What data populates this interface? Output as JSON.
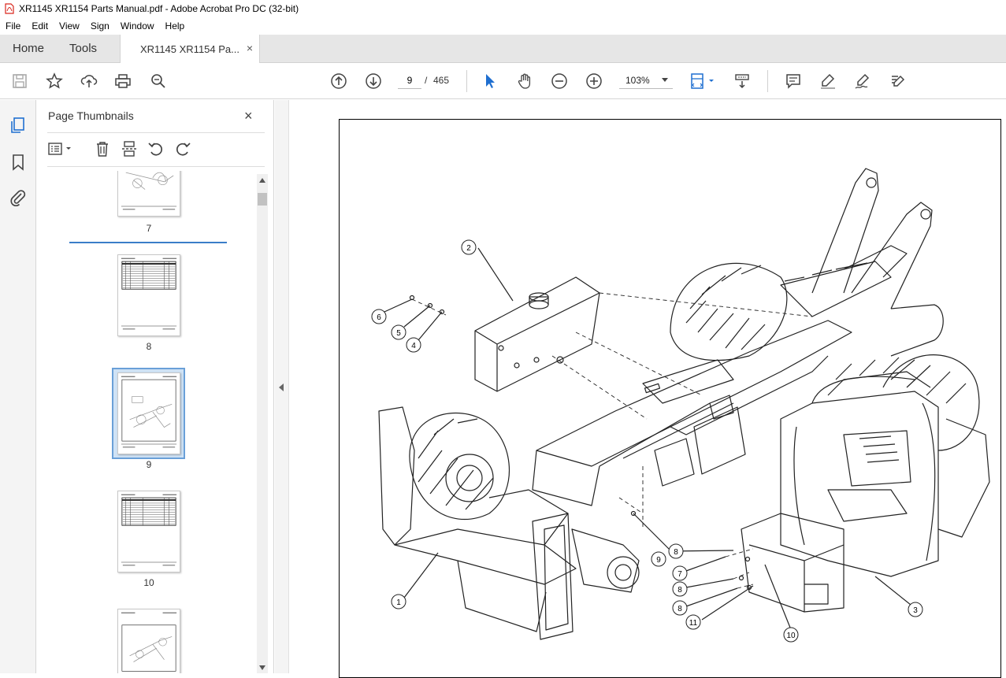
{
  "window": {
    "title": "XR1145 XR1154 Parts Manual.pdf - Adobe Acrobat Pro DC (32-bit)"
  },
  "menu": [
    "File",
    "Edit",
    "View",
    "Sign",
    "Window",
    "Help"
  ],
  "tabs": {
    "home": "Home",
    "tools": "Tools",
    "document": "XR1145 XR1154 Pa...",
    "document_close": "×"
  },
  "toolbar": {
    "current_page": "9",
    "page_separator": "/",
    "total_pages": "465",
    "zoom": "103%",
    "icons": [
      "save-icon",
      "star-icon",
      "upload-icon",
      "print-icon",
      "search-zoom-icon",
      "page-up-icon",
      "page-down-icon",
      "select-arrow-icon",
      "hand-icon",
      "zoom-out-icon",
      "zoom-in-icon",
      "fit-page-icon",
      "scroll-mode-icon",
      "comment-icon",
      "highlight-icon",
      "sign-icon",
      "edit-icon"
    ]
  },
  "panel": {
    "title": "Page Thumbnails",
    "close": "×",
    "thumbnails": [
      {
        "label": "7"
      },
      {
        "label": "8"
      },
      {
        "label": "9",
        "selected": true
      },
      {
        "label": "10"
      },
      {
        "label": ""
      }
    ]
  },
  "diagram": {
    "callouts": [
      "1",
      "2",
      "3",
      "4",
      "5",
      "6",
      "7",
      "8",
      "8",
      "8",
      "9",
      "10",
      "11"
    ]
  },
  "colors": {
    "accent": "#3b7dc8",
    "selection": "#cfe2f5",
    "acrobat_red": "#d9261c"
  }
}
